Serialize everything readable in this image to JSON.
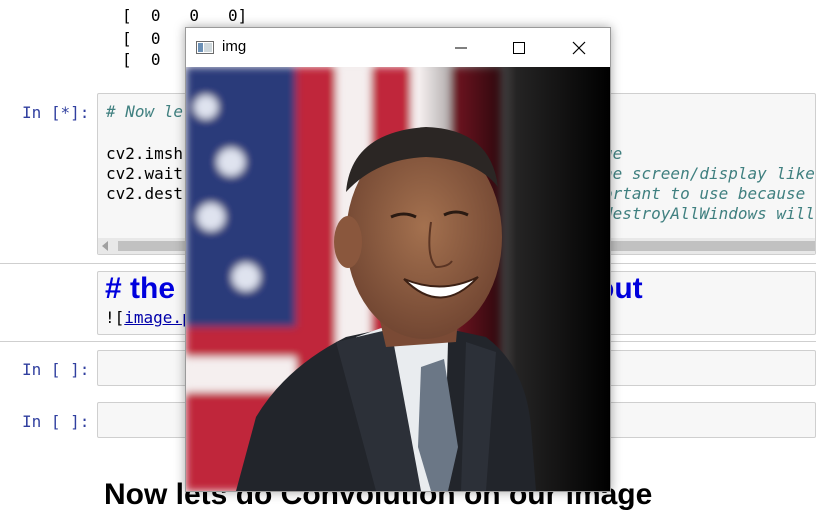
{
  "output": {
    "lines": [
      "[  0   0   0]",
      "[  0",
      "[  0"
    ]
  },
  "cells": {
    "code_cell": {
      "prompt": "In [*]:",
      "lines": [
        {
          "left": "# Now le",
          "right": ""
        },
        {
          "left": "",
          "right": ""
        },
        {
          "left": "cv2.imsh",
          "right": "ge"
        },
        {
          "left": "cv2.wait",
          "right": "he screen/display like"
        },
        {
          "left": "cv2.dest",
          "right": "ortant to use because"
        },
        {
          "left": "",
          "right": "destroyAllWindows will"
        }
      ]
    },
    "markdown_cell": {
      "heading_left": "# the",
      "heading_right": "out",
      "link_prefix": "![",
      "link_text": "image.p"
    },
    "empty_cell_1": {
      "prompt": "In [ ]:"
    },
    "empty_cell_2": {
      "prompt": "In [ ]:"
    }
  },
  "section_heading": "Now lets do Convolution on our image",
  "window": {
    "title": "img",
    "icons": [
      "app-icon",
      "minimize-icon",
      "maximize-icon",
      "close-icon"
    ]
  },
  "colors": {
    "prompt": "#303f9f",
    "comment": "#408080",
    "markdown_heading": "#0000dd"
  }
}
